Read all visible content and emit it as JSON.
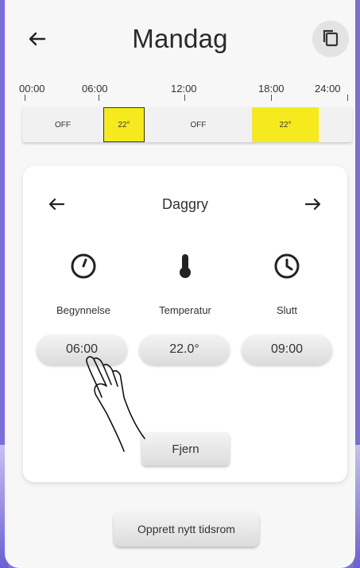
{
  "header": {
    "title": "Mandag",
    "back_icon": "arrow-left-icon",
    "copy_icon": "copy-icon"
  },
  "timeline": {
    "ticks": [
      "00:00",
      "06:00",
      "12:00",
      "18:00",
      "24:00"
    ],
    "segments": [
      {
        "label": "OFF",
        "state": "off"
      },
      {
        "label": "22°",
        "state": "on",
        "selected": true
      },
      {
        "label": "OFF",
        "state": "off"
      },
      {
        "label": "22°",
        "state": "on"
      }
    ],
    "on_color": "#f6ea1e"
  },
  "card": {
    "title": "Daggry",
    "prev_icon": "arrow-left-icon",
    "next_icon": "arrow-right-icon",
    "columns": [
      {
        "icon": "clock-start-icon",
        "label": "Begynnelse",
        "value": "06:00"
      },
      {
        "icon": "thermometer-icon",
        "label": "Temperatur",
        "value": "22.0°"
      },
      {
        "icon": "clock-end-icon",
        "label": "Slutt",
        "value": "09:00"
      }
    ],
    "remove_label": "Fjern"
  },
  "footer": {
    "new_slot_label": "Opprett nytt tidsrom"
  }
}
